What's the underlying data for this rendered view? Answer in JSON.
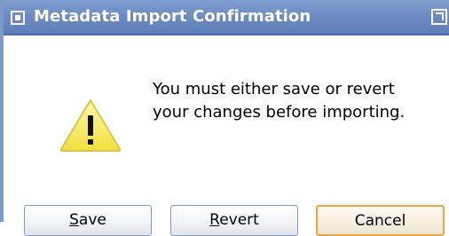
{
  "window": {
    "title": "Metadata Import Confirmation"
  },
  "message": {
    "line1": "You must either save or revert",
    "line2": "your changes before importing."
  },
  "icons": {
    "window_menu": "window-menu-icon",
    "maximize": "maximize-icon",
    "warning": "warning-triangle-icon"
  },
  "buttons": {
    "save": {
      "mnemonic": "S",
      "rest": "ave"
    },
    "revert": {
      "mnemonic": "R",
      "rest": "evert"
    },
    "cancel": {
      "label": "Cancel"
    }
  },
  "colors": {
    "titlebar": "#6c8bc2",
    "warning_fill": "#f7ea5a",
    "default_button_border": "#e7a843"
  }
}
